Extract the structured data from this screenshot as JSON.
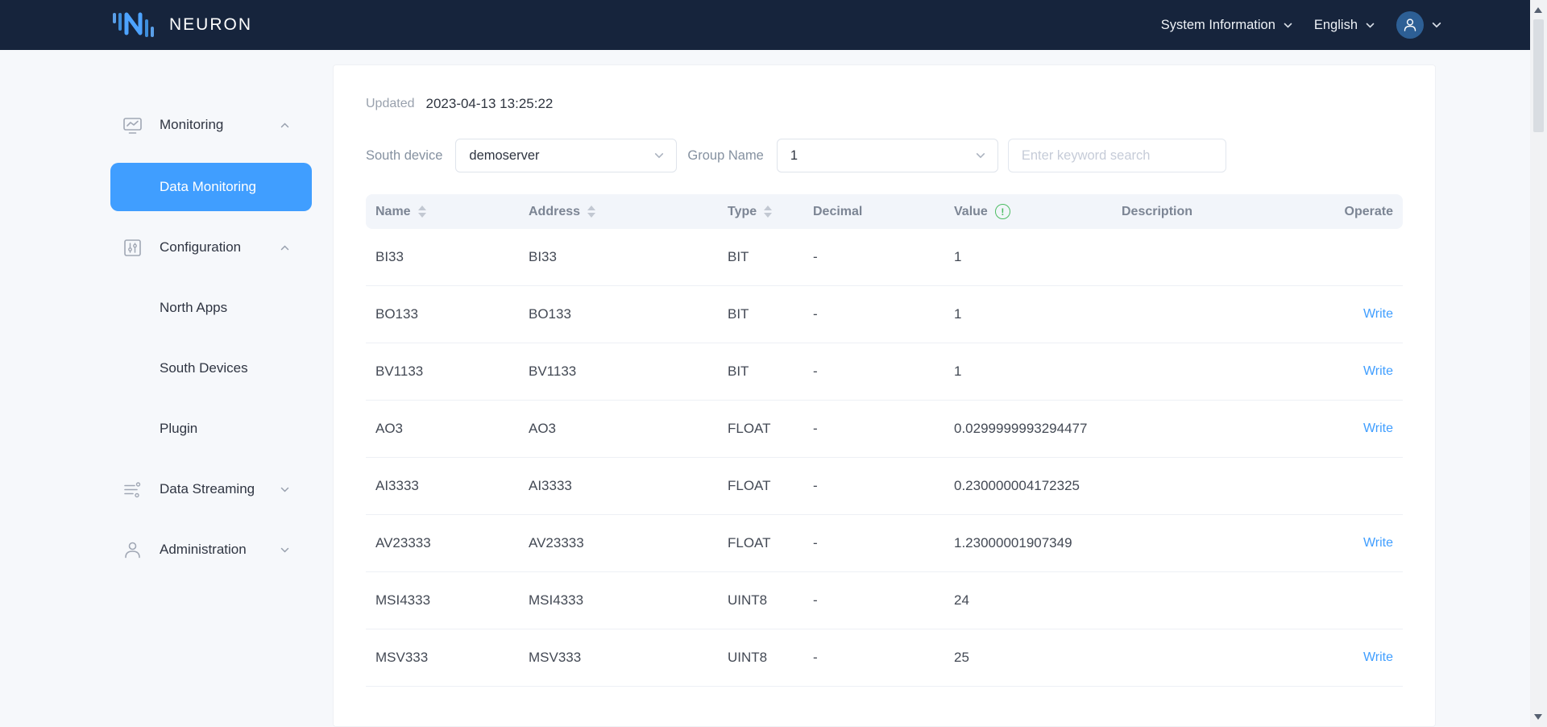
{
  "header": {
    "brand": "NEURON",
    "system_info_label": "System Information",
    "language_label": "English"
  },
  "sidebar": {
    "items": [
      {
        "label": "Monitoring"
      },
      {
        "label": "Data Monitoring"
      },
      {
        "label": "Configuration"
      },
      {
        "label": "North Apps"
      },
      {
        "label": "South Devices"
      },
      {
        "label": "Plugin"
      },
      {
        "label": "Data Streaming"
      },
      {
        "label": "Administration"
      }
    ]
  },
  "main": {
    "updated_label": "Updated",
    "updated_value": "2023-04-13 13:25:22",
    "filters": {
      "south_device_label": "South device",
      "south_device_value": "demoserver",
      "group_name_label": "Group Name",
      "group_name_value": "1",
      "search_placeholder": "Enter keyword search"
    },
    "table": {
      "columns": [
        "Name",
        "Address",
        "Type",
        "Decimal",
        "Value",
        "Description",
        "Operate"
      ],
      "write_label": "Write",
      "rows": [
        {
          "name": "BI33",
          "address": "BI33",
          "type": "BIT",
          "decimal": "-",
          "value": "1",
          "description": "",
          "write": false
        },
        {
          "name": "BO133",
          "address": "BO133",
          "type": "BIT",
          "decimal": "-",
          "value": "1",
          "description": "",
          "write": true
        },
        {
          "name": "BV1133",
          "address": "BV1133",
          "type": "BIT",
          "decimal": "-",
          "value": "1",
          "description": "",
          "write": true
        },
        {
          "name": "AO3",
          "address": "AO3",
          "type": "FLOAT",
          "decimal": "-",
          "value": "0.0299999993294477",
          "description": "",
          "write": true
        },
        {
          "name": "AI3333",
          "address": "AI3333",
          "type": "FLOAT",
          "decimal": "-",
          "value": "0.230000004172325",
          "description": "",
          "write": false
        },
        {
          "name": "AV23333",
          "address": "AV23333",
          "type": "FLOAT",
          "decimal": "-",
          "value": "1.23000001907349",
          "description": "",
          "write": true
        },
        {
          "name": "MSI4333",
          "address": "MSI4333",
          "type": "UINT8",
          "decimal": "-",
          "value": "24",
          "description": "",
          "write": false
        },
        {
          "name": "MSV333",
          "address": "MSV333",
          "type": "UINT8",
          "decimal": "-",
          "value": "25",
          "description": "",
          "write": true
        }
      ]
    }
  },
  "colors": {
    "topbar_bg": "#16243c",
    "primary_blue": "#409eff",
    "link_blue": "#409eff",
    "table_header_bg": "#f2f5fa",
    "page_bg": "#f6f8fb",
    "info_icon_green": "#4dbd63"
  }
}
